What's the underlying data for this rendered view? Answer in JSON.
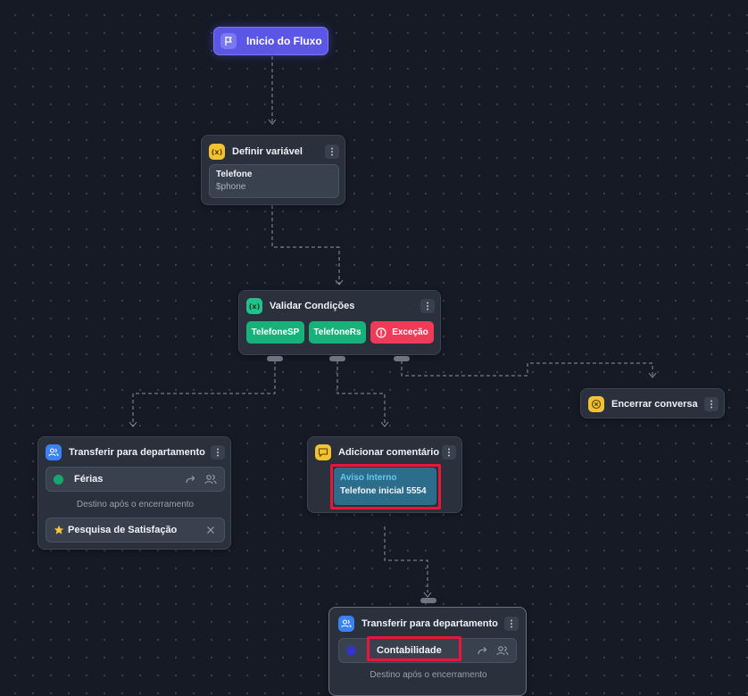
{
  "start": {
    "label": "Inicio do Fluxo",
    "icon": "flag-icon"
  },
  "set_variable": {
    "title": "Definir variável",
    "variable_name": "Telefone",
    "variable_value": "$phone",
    "icon": "variable-icon"
  },
  "validate": {
    "title": "Validar Condições",
    "icon": "variable-icon",
    "conditions": [
      "TelefoneSP",
      "TelefoneRs"
    ],
    "exception_label": "Exceção"
  },
  "end_conversation": {
    "title": "Encerrar conversa",
    "icon": "close-circle-icon"
  },
  "transfer_left": {
    "title": "Transferir para departamento",
    "department": "Férias",
    "after_end_label": "Destino após o encerramento",
    "survey": "Pesquisa de Satisfação"
  },
  "comment": {
    "title": "Adicionar comentário",
    "heading": "Aviso Interno",
    "text": "Telefone inicial 5554"
  },
  "transfer_bottom": {
    "title": "Transferir para departamento",
    "department": "Contabilidade",
    "after_end_label": "Destino após o encerramento"
  },
  "colors": {
    "background": "#151a25",
    "node": "#2a303c",
    "accent": "#5b56e6",
    "success": "#17b27a",
    "danger": "#ef3b57",
    "highlight": "#e8173a"
  }
}
